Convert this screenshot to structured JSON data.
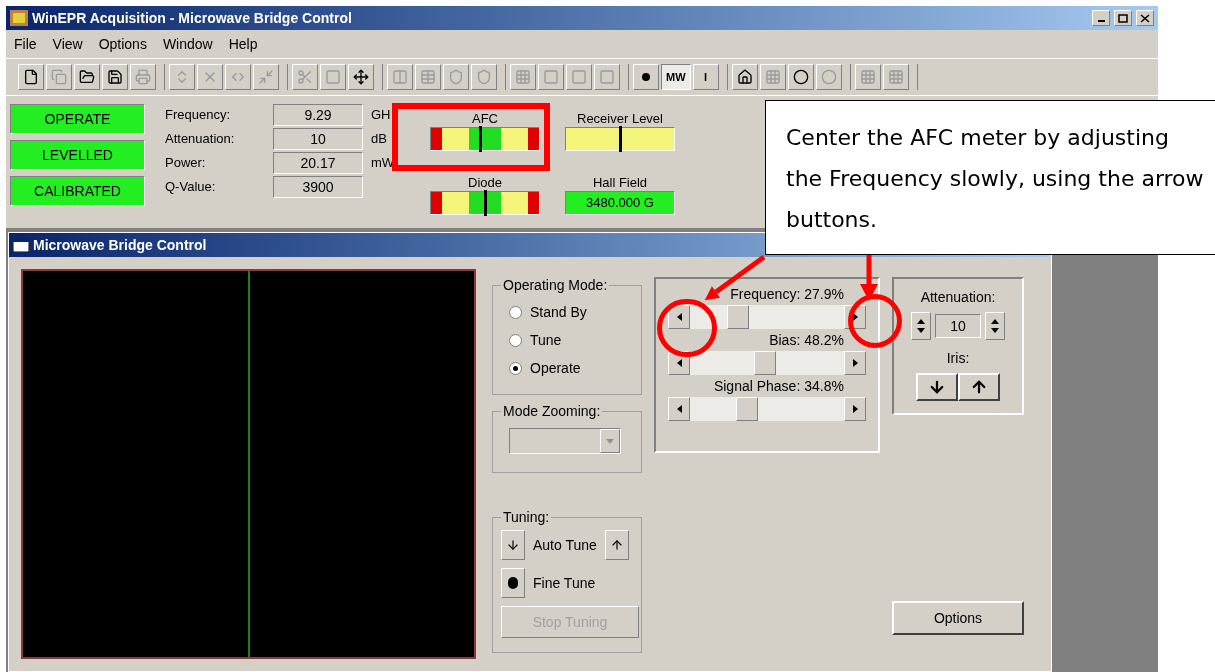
{
  "window": {
    "title": "WinEPR Acquisition - Microwave Bridge Control"
  },
  "menu": [
    "File",
    "View",
    "Options",
    "Window",
    "Help"
  ],
  "toolbar_labels": [
    {
      "label": "MW",
      "selected": true
    },
    {
      "label": "I",
      "selected": false
    }
  ],
  "status_lamps": [
    {
      "label": "OPERATE",
      "on": true
    },
    {
      "label": "LEVELLED",
      "on": true
    },
    {
      "label": "CALIBRATED",
      "on": true
    }
  ],
  "readouts": [
    {
      "label": "Frequency:",
      "value": "9.29",
      "unit": "GH"
    },
    {
      "label": "Attenuation:",
      "value": "10",
      "unit": "dB"
    },
    {
      "label": "Power:",
      "value": "20.17",
      "unit": "mW"
    },
    {
      "label": "Q-Value:",
      "value": "3900"
    }
  ],
  "meters": [
    {
      "label": "AFC",
      "kind": "tricolor",
      "level": 0.45
    },
    {
      "label": "Receiver Level",
      "kind": "yellow",
      "level": 0.5
    },
    {
      "label": "Diode",
      "kind": "tricolor",
      "level": 0.5
    },
    {
      "label": "Hall Field",
      "kind": "display",
      "value": "3480.000 G"
    }
  ],
  "child_window": {
    "title": "Microwave Bridge Control"
  },
  "operating_mode": {
    "label": "Operating Mode:",
    "options": [
      {
        "label": "Stand By",
        "selected": false
      },
      {
        "label": "Tune",
        "selected": false
      },
      {
        "label": "Operate",
        "selected": true
      }
    ]
  },
  "mode_zooming": {
    "label": "Mode Zooming:",
    "disabled": true
  },
  "sliders": [
    {
      "label": "Frequency:",
      "reading": "27.9%",
      "level": 0.279
    },
    {
      "label": "Bias:",
      "reading": "48.2%",
      "level": 0.482
    },
    {
      "label": "Signal Phase:",
      "reading": "34.8%",
      "level": 0.348
    }
  ],
  "attenuation": {
    "label": "Attenuation:",
    "value": "10",
    "iris_label": "Iris:"
  },
  "tuning": {
    "label": "Tuning:",
    "auto_tune": "Auto Tune",
    "fine_tune": "Fine Tune",
    "stop": {
      "label": "Stop Tuning",
      "disabled": true
    }
  },
  "options_button": "Options",
  "callout": "Center the AFC meter by adjusting the Frequency slowly, using the arrow buttons."
}
